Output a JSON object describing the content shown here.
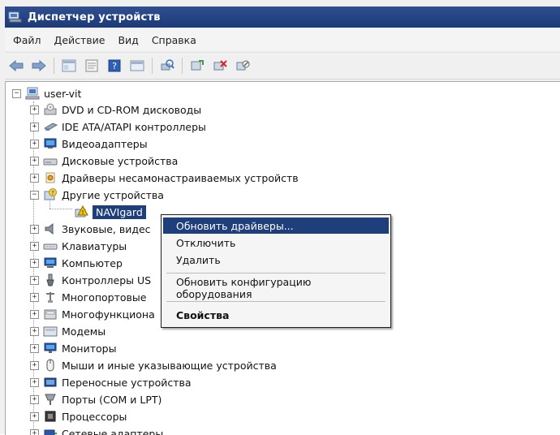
{
  "window": {
    "title": "Диспетчер устройств"
  },
  "menubar": {
    "items": [
      "Файл",
      "Действие",
      "Вид",
      "Справка"
    ]
  },
  "toolbar": {
    "icons": [
      "back-arrow-icon",
      "forward-arrow-icon",
      "show-hide-console-tree-icon",
      "properties-icon",
      "help-icon",
      "view-icon",
      "scan-hardware-icon",
      "update-driver-icon",
      "uninstall-icon",
      "disable-icon"
    ]
  },
  "tree": {
    "root": "user-vit",
    "categories": [
      {
        "label": "DVD и CD-ROM дисководы",
        "icon": "dvd-drive-icon"
      },
      {
        "label": "IDE ATA/ATAPI контроллеры",
        "icon": "ide-controller-icon"
      },
      {
        "label": "Видеоадаптеры",
        "icon": "display-adapter-icon"
      },
      {
        "label": "Дисковые устройства",
        "icon": "disk-drive-icon"
      },
      {
        "label": "Драйверы несамонастраиваемых устройств",
        "icon": "non-pnp-driver-icon"
      },
      {
        "label": "Другие устройства",
        "icon": "other-devices-icon",
        "expanded": true
      },
      {
        "label": "NAVIgard",
        "icon": "warning-device-icon",
        "child": true,
        "selected": true
      },
      {
        "label": "Звуковые, видео и игровые устройства",
        "visible": "Звуковые, видес",
        "icon": "sound-icon"
      },
      {
        "label": "Клавиатуры",
        "icon": "keyboard-icon"
      },
      {
        "label": "Компьютер",
        "icon": "computer-icon"
      },
      {
        "label": "Контроллеры USB",
        "visible": "Контроллеры US",
        "icon": "usb-icon"
      },
      {
        "label": "Многопортовые последовательные адаптеры",
        "visible": "Многопортовые ",
        "icon": "multiport-icon"
      },
      {
        "label": "Многофункциональные устройства",
        "visible": "Многофункциона",
        "icon": "multifunction-icon"
      },
      {
        "label": "Модемы",
        "icon": "modem-icon"
      },
      {
        "label": "Мониторы",
        "icon": "monitor-icon"
      },
      {
        "label": "Мыши и иные указывающие устройства",
        "icon": "mouse-icon"
      },
      {
        "label": "Переносные устройства",
        "icon": "portable-device-icon"
      },
      {
        "label": "Порты (COM и LPT)",
        "icon": "port-icon"
      },
      {
        "label": "Процессоры",
        "icon": "processor-icon"
      },
      {
        "label": "Сетевые адаптеры",
        "icon": "network-adapter-icon"
      }
    ]
  },
  "context_menu": {
    "items": [
      {
        "label": "Обновить драйверы...",
        "highlighted": true
      },
      {
        "label": "Отключить"
      },
      {
        "label": "Удалить"
      },
      {
        "label": "Обновить конфигурацию оборудования"
      },
      {
        "label": "Свойства",
        "bold": true
      }
    ]
  },
  "colors": {
    "selection": "#1f3f7c",
    "titlebar": "#1d3a78"
  }
}
